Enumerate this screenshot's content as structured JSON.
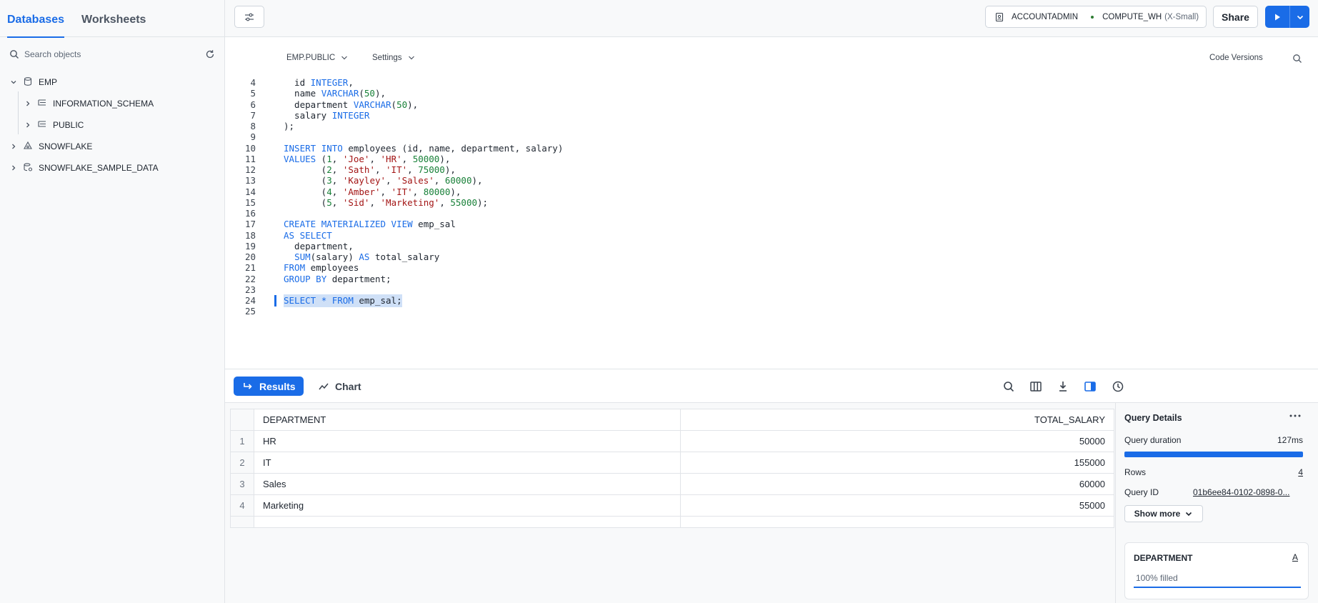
{
  "sidebar": {
    "tabs": [
      "Databases",
      "Worksheets"
    ],
    "search_placeholder": "Search objects",
    "tree": [
      {
        "label": "EMP",
        "type": "database",
        "expanded": true
      },
      {
        "label": "INFORMATION_SCHEMA",
        "type": "schema"
      },
      {
        "label": "PUBLIC",
        "type": "schema"
      },
      {
        "label": "SNOWFLAKE",
        "type": "app"
      },
      {
        "label": "SNOWFLAKE_SAMPLE_DATA",
        "type": "shared-database"
      }
    ]
  },
  "topbar": {
    "role": "ACCOUNTADMIN",
    "warehouse": "COMPUTE_WH",
    "warehouse_size": "(X-Small)",
    "share_label": "Share"
  },
  "editor_toolbar": {
    "context": "EMP.PUBLIC",
    "settings": "Settings",
    "code_versions": "Code Versions"
  },
  "editor": {
    "active_line": 24,
    "lines": [
      {
        "n": 4,
        "text": "  id INTEGER,"
      },
      {
        "n": 5,
        "text": "  name VARCHAR(50),"
      },
      {
        "n": 6,
        "text": "  department VARCHAR(50),"
      },
      {
        "n": 7,
        "text": "  salary INTEGER"
      },
      {
        "n": 8,
        "text": ");"
      },
      {
        "n": 9,
        "text": ""
      },
      {
        "n": 10,
        "text": "INSERT INTO employees (id, name, department, salary)"
      },
      {
        "n": 11,
        "text": "VALUES (1, 'Joe', 'HR', 50000),"
      },
      {
        "n": 12,
        "text": "       (2, 'Sath', 'IT', 75000),"
      },
      {
        "n": 13,
        "text": "       (3, 'Kayley', 'Sales', 60000),"
      },
      {
        "n": 14,
        "text": "       (4, 'Amber', 'IT', 80000),"
      },
      {
        "n": 15,
        "text": "       (5, 'Sid', 'Marketing', 55000);"
      },
      {
        "n": 16,
        "text": ""
      },
      {
        "n": 17,
        "text": "CREATE MATERIALIZED VIEW emp_sal"
      },
      {
        "n": 18,
        "text": "AS SELECT"
      },
      {
        "n": 19,
        "text": "  department,"
      },
      {
        "n": 20,
        "text": "  SUM(salary) AS total_salary"
      },
      {
        "n": 21,
        "text": "FROM employees"
      },
      {
        "n": 22,
        "text": "GROUP BY department;"
      },
      {
        "n": 23,
        "text": ""
      },
      {
        "n": 24,
        "text": "SELECT * FROM emp_sal;"
      },
      {
        "n": 25,
        "text": ""
      }
    ]
  },
  "results_toolbar": {
    "results_label": "Results",
    "chart_label": "Chart"
  },
  "results": {
    "columns": [
      "DEPARTMENT",
      "TOTAL_SALARY"
    ],
    "rows": [
      [
        "1",
        "HR",
        "50000"
      ],
      [
        "2",
        "IT",
        "155000"
      ],
      [
        "3",
        "Sales",
        "60000"
      ],
      [
        "4",
        "Marketing",
        "55000"
      ]
    ]
  },
  "query_details": {
    "title": "Query Details",
    "duration_label": "Query duration",
    "duration_value": "127ms",
    "rows_label": "Rows",
    "rows_value": "4",
    "query_id_label": "Query ID",
    "query_id_value": "01b6ee84-0102-0898-0...",
    "show_more": "Show more",
    "column_card": {
      "name": "DEPARTMENT",
      "type_glyph": "A",
      "filled": "100% filled"
    }
  },
  "colors": {
    "accent": "#1a6ce7",
    "keyword": "#1a6ce7",
    "number": "#188038",
    "string": "#a31515"
  }
}
